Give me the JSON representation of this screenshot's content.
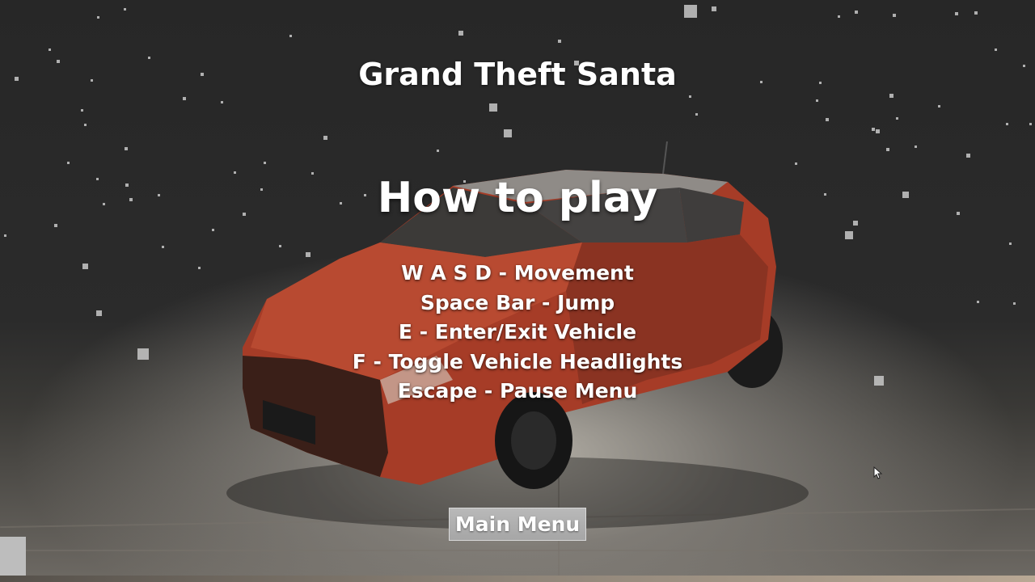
{
  "game": {
    "title": "Grand Theft Santa"
  },
  "help_screen": {
    "heading": "How to play",
    "controls": [
      "W A S D - Movement",
      "Space Bar - Jump",
      "E - Enter/Exit Vehicle",
      "F - Toggle Vehicle Headlights",
      "Escape - Pause Menu"
    ],
    "main_menu_button": "Main Menu"
  },
  "colors": {
    "text": "#ffffff",
    "button": "#b0b0b0",
    "car_body": "#b3412a",
    "background": "#272727"
  },
  "icons": [
    "mouse-cursor-icon"
  ]
}
